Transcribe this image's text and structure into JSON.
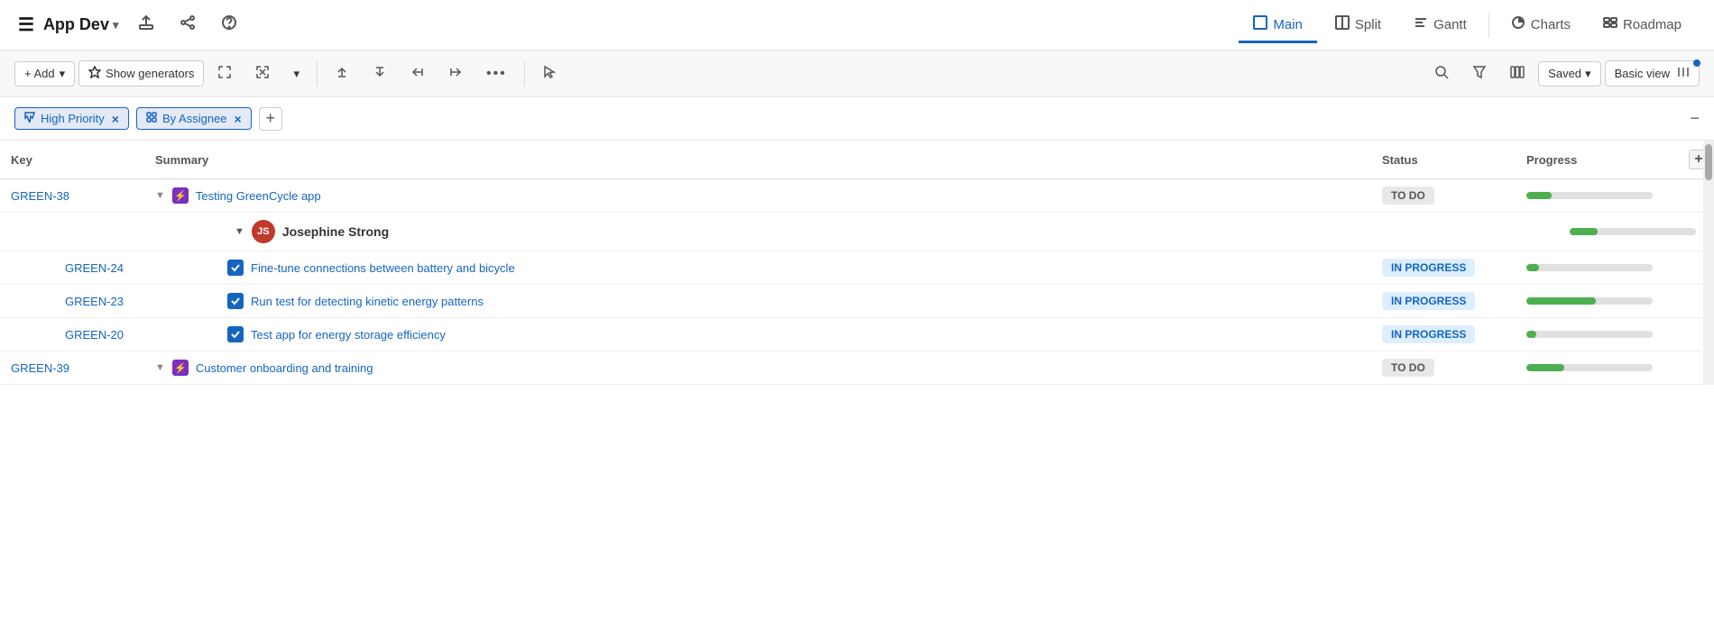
{
  "app": {
    "title": "App Dev",
    "title_arrow": "▾"
  },
  "nav_icons": {
    "menu": "☰",
    "share_up": "⬆",
    "share_net": "⚹",
    "help": "?"
  },
  "view_tabs": [
    {
      "label": "Main",
      "icon": "□",
      "active": true
    },
    {
      "label": "Split",
      "icon": "⊟",
      "active": false
    },
    {
      "label": "Gantt",
      "icon": "≡",
      "active": false
    },
    {
      "label": "Charts",
      "icon": "◎",
      "active": false
    },
    {
      "label": "Roadmap",
      "icon": "⊞",
      "active": false
    }
  ],
  "toolbar": {
    "add_label": "+ Add",
    "add_arrow": "▾",
    "show_generators_label": "Show generators",
    "expand_icon": "⤢",
    "collapse_icon": "⤡",
    "arrow_down": "▾",
    "move_up_icon": "⬆",
    "move_down_icon": "⬇",
    "indent_left": "⇤",
    "indent_right": "⇥",
    "more_icon": "•••",
    "cursor_icon": "↖",
    "search_icon": "🔍",
    "filter_icon": "▽",
    "columns_icon": "⊞",
    "saved_label": "Saved",
    "saved_arrow": "▾",
    "basic_view_label": "Basic view",
    "columns_view_icon": "|||"
  },
  "filters": [
    {
      "label": "High Priority",
      "removable": true,
      "icon": "▽"
    },
    {
      "label": "By Assignee",
      "removable": true,
      "icon": "⊞"
    }
  ],
  "table": {
    "columns": [
      {
        "id": "key",
        "label": "Key"
      },
      {
        "id": "summary",
        "label": "Summary"
      },
      {
        "id": "status",
        "label": "Status"
      },
      {
        "id": "progress",
        "label": "Progress"
      }
    ],
    "rows": [
      {
        "id": "row-green38",
        "type": "task",
        "level": 0,
        "key": "GREEN-38",
        "has_chevron": true,
        "icon_type": "purple",
        "icon_label": "⚡",
        "summary": "Testing GreenCycle app",
        "status": "TO DO",
        "status_class": "todo",
        "progress": 20
      },
      {
        "id": "row-josephine",
        "type": "assignee",
        "level": 1,
        "key": "",
        "has_chevron": true,
        "avatar_initials": "JS",
        "avatar_color": "#c0392b",
        "summary": "Josephine Strong",
        "status": "",
        "progress": 22
      },
      {
        "id": "row-green24",
        "type": "subtask",
        "level": 2,
        "key": "GREEN-24",
        "has_chevron": false,
        "icon_type": "check",
        "summary": "Fine-tune connections between battery and bicycle",
        "status": "IN PROGRESS",
        "status_class": "inprogress",
        "progress": 10
      },
      {
        "id": "row-green23",
        "type": "subtask",
        "level": 2,
        "key": "GREEN-23",
        "has_chevron": false,
        "icon_type": "check",
        "summary": "Run test for detecting kinetic energy patterns",
        "status": "IN PROGRESS",
        "status_class": "inprogress",
        "progress": 55
      },
      {
        "id": "row-green20",
        "type": "subtask",
        "level": 2,
        "key": "GREEN-20",
        "has_chevron": false,
        "icon_type": "check",
        "summary": "Test app for energy storage efficiency",
        "status": "IN PROGRESS",
        "status_class": "inprogress",
        "progress": 8
      },
      {
        "id": "row-green39",
        "type": "task",
        "level": 0,
        "key": "GREEN-39",
        "has_chevron": true,
        "icon_type": "purple",
        "icon_label": "⚡",
        "summary": "Customer onboarding and training",
        "status": "TO DO",
        "status_class": "todo",
        "progress": 30
      }
    ]
  }
}
